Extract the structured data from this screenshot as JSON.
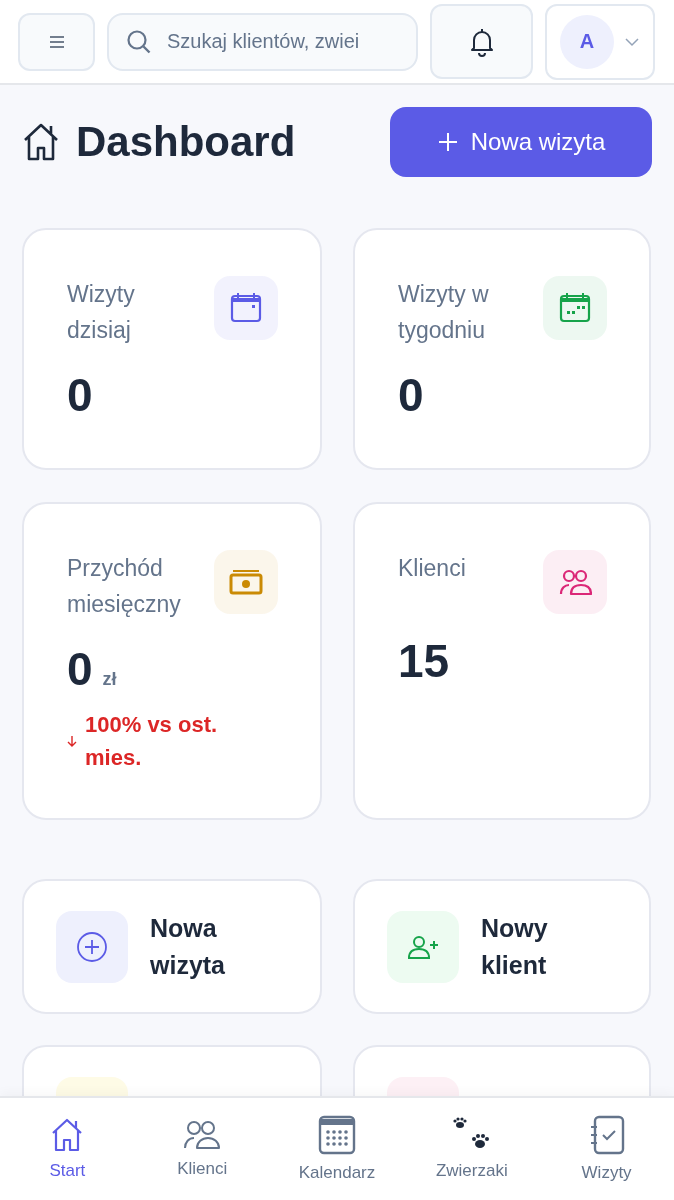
{
  "header": {
    "search": {
      "placeholder": "Szukaj klientów, zwiei"
    },
    "avatar": {
      "initial": "A"
    }
  },
  "page": {
    "title": "Dashboard",
    "primary_button": "Nowa wizyta"
  },
  "stats": [
    {
      "label": "Wizyty dzisiaj",
      "value": "0",
      "color": "#5b5be6"
    },
    {
      "label": "Wizyty w tygodniu",
      "value": "0",
      "color": "#16a34a"
    },
    {
      "label": "Przychód miesięczny",
      "value": "0",
      "unit": "zł",
      "color": "#ca8a04",
      "trend": {
        "decrease": true,
        "text": "100% vs ost. mies."
      }
    },
    {
      "label": "Klienci",
      "value": "15",
      "color": "#db2777"
    }
  ],
  "quick_actions": [
    {
      "label": "Nowa wizyta",
      "color": "#eef0fd"
    },
    {
      "label": "Nowy klient",
      "color": "#edfbf1"
    },
    {
      "color": "#fefbe6"
    },
    {
      "color": "#fdf0f5"
    }
  ],
  "bottom_nav": [
    {
      "label": "Start",
      "selected": true
    },
    {
      "label": "Klienci",
      "selected": false
    },
    {
      "label": "Kalendarz",
      "selected": false
    },
    {
      "label": "Zwierzaki",
      "selected": false
    },
    {
      "label": "Wizyty",
      "selected": false
    }
  ]
}
